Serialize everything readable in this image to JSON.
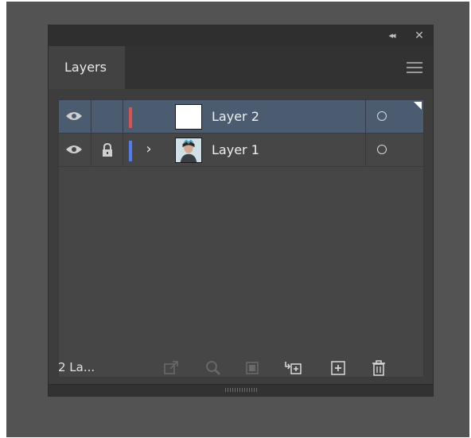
{
  "panel": {
    "tab_label": "Layers",
    "count_label": "2 La..."
  },
  "titlebar": {
    "collapse_icon": "double-chevron-left-icon",
    "close_icon": "close-icon"
  },
  "layers": [
    {
      "name": "Layer 2",
      "color": "#e05050",
      "selected": true,
      "locked": false,
      "expandable": false,
      "thumbnail": "blank-white"
    },
    {
      "name": "Layer 1",
      "color": "#4f7df0",
      "selected": false,
      "locked": true,
      "expandable": true,
      "thumbnail": "photo-portrait"
    }
  ],
  "footer_buttons": [
    "collect-for-export-icon",
    "locate-object-icon",
    "make-clipping-mask-icon",
    "create-new-sublayer-icon",
    "create-new-layer-icon",
    "delete-layer-icon"
  ]
}
